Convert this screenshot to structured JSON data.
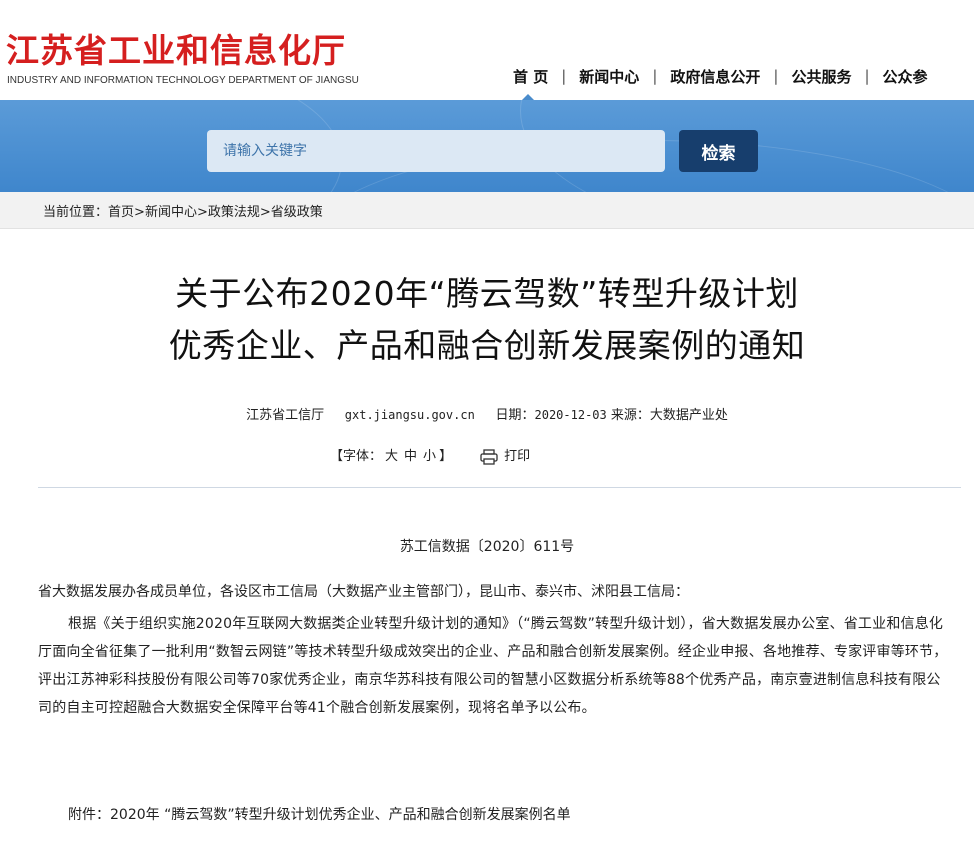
{
  "header": {
    "site_name_cn": "江苏省工业和信息化厅",
    "site_name_en": "INDUSTRY AND INFORMATION TECHNOLOGY DEPARTMENT OF JIANGSU",
    "brand_color": "#d51f1f",
    "nav": [
      "首 页",
      "新闻中心",
      "政府信息公开",
      "公共服务",
      "公众参"
    ]
  },
  "search": {
    "placeholder": "请输入关键字",
    "button_label": "检索",
    "banner_color": "#4a8ccc",
    "button_color": "#173e6d"
  },
  "breadcrumb": {
    "prefix": "当前位置：",
    "items": [
      "首页",
      "新闻中心",
      "政策法规",
      "省级政策"
    ],
    "separator": ">"
  },
  "article": {
    "title_line1": "关于公布2020年“腾云驾数”转型升级计划",
    "title_line2": "优秀企业、产品和融合创新发展案例的通知",
    "publisher": "江苏省工信厅",
    "site": "gxt.jiangsu.gov.cn",
    "date_label": "日期：",
    "date": "2020-12-03",
    "source_label": "来源：",
    "source": "大数据产业处",
    "font_label": "【字体：",
    "font_sizes": [
      "大",
      "中",
      "小"
    ],
    "font_close": "】",
    "print_label": "打印",
    "doc_number": "苏工信数据〔2020〕611号",
    "recipients": "省大数据发展办各成员单位，各设区市工信局（大数据产业主管部门），昆山市、泰兴市、沭阳县工信局：",
    "body": "根据《关于组织实施2020年互联网大数据类企业转型升级计划的通知》（“腾云驾数”转型升级计划），省大数据发展办公室、省工业和信息化厅面向全省征集了一批利用“数智云网链”等技术转型升级成效突出的企业、产品和融合创新发展案例。经企业申报、各地推荐、专家评审等环节，评出江苏神彩科技股份有限公司等70家优秀企业，南京华苏科技有限公司的智慧小区数据分析系统等88个优秀产品，南京壹进制信息科技有限公司的自主可控超融合大数据安全保障平台等41个融合创新发展案例，现将名单予以公布。",
    "attachment": "附件：2020年 “腾云驾数”转型升级计划优秀企业、产品和融合创新发展案例名单"
  }
}
